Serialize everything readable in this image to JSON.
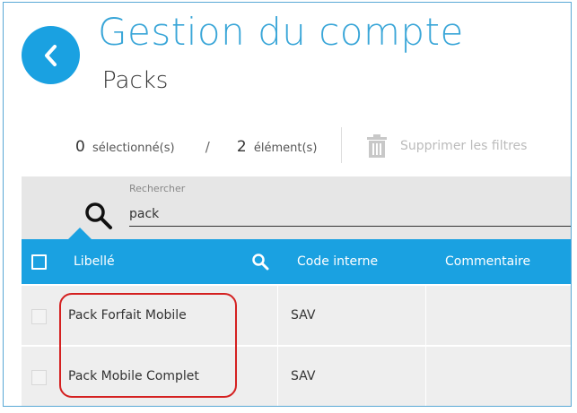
{
  "header": {
    "title": "Gestion du compte",
    "subtitle": "Packs"
  },
  "selection": {
    "selected_count": "0",
    "selected_label": "sélectionné(s)",
    "separator": "/",
    "total_count": "2",
    "total_label": "élément(s)",
    "clear_filters_label": "Supprimer les filtres"
  },
  "search": {
    "label": "Rechercher",
    "value": "pack"
  },
  "table": {
    "columns": [
      "Libellé",
      "Code interne",
      "Commentaire"
    ],
    "rows": [
      {
        "libelle": "Pack Forfait Mobile",
        "code": "SAV",
        "commentaire": ""
      },
      {
        "libelle": "Pack Mobile Complet",
        "code": "SAV",
        "commentaire": ""
      }
    ]
  },
  "colors": {
    "accent": "#1aa1e1",
    "title": "#3aa6d8",
    "highlight": "#d42020"
  },
  "icons": {
    "back": "chevron-left-icon",
    "search": "search-icon",
    "trash": "trash-icon"
  }
}
